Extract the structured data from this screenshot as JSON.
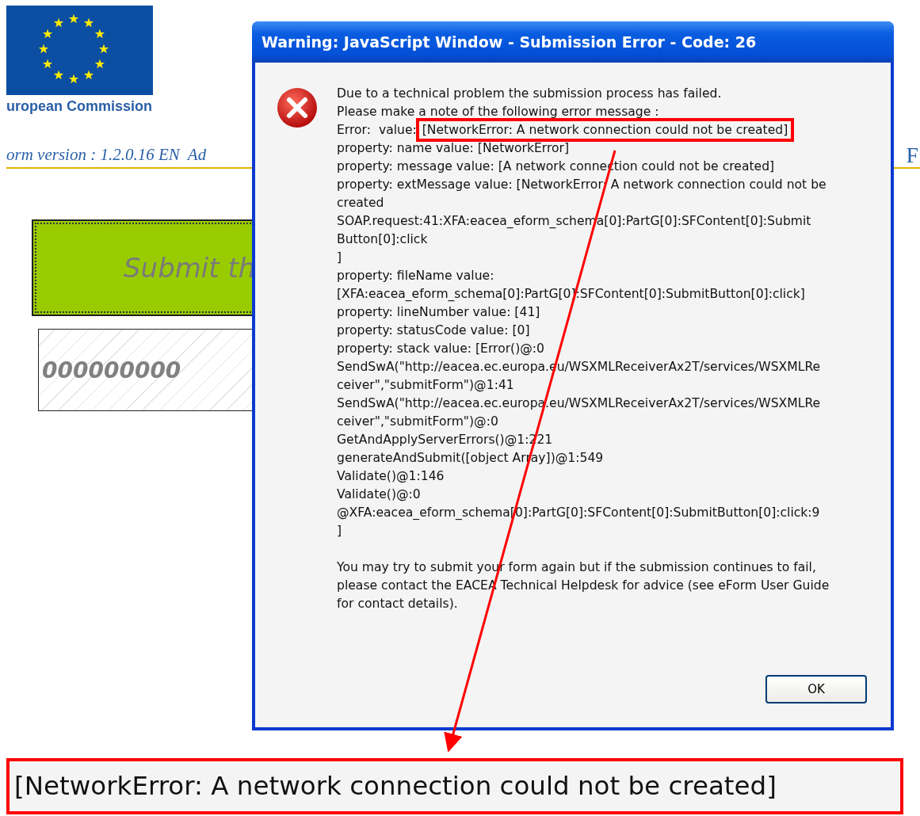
{
  "background_page": {
    "logo_caption": "uropean Commission",
    "form_version": "orm version : 1.2.0.16 EN  Ad",
    "right_heading": "F",
    "submit_button": "Submit th",
    "reference_field": {
      "value": "000000000"
    }
  },
  "dialog": {
    "title": "Warning: JavaScript Window - Submission Error - Code: 26",
    "message_lines": [
      {
        "text": "Due to a technical problem the submission process has failed."
      },
      {
        "text": "Please make a note of the following error message :"
      },
      {
        "text": "Error:  value: ",
        "highlight": "[NetworkError: A network connection could not be created]"
      },
      {
        "text": "property: name value: [NetworkError]"
      },
      {
        "text": "property: message value: [A network connection could not be created]"
      },
      {
        "text": "property: extMessage value: [NetworkError: A network connection could not be"
      },
      {
        "text": "created"
      },
      {
        "text": "SOAP.request:41:XFA:eacea_eform_schema[0]:PartG[0]:SFContent[0]:Submit"
      },
      {
        "text": "Button[0]:click"
      },
      {
        "text": "]"
      },
      {
        "text": "property: fileName value:"
      },
      {
        "text": "[XFA:eacea_eform_schema[0]:PartG[0]:SFContent[0]:SubmitButton[0]:click]"
      },
      {
        "text": "property: lineNumber value: [41]"
      },
      {
        "text": "property: statusCode value: [0]"
      },
      {
        "text": "property: stack value: [Error()@:0"
      },
      {
        "text": "SendSwA(\"http://eacea.ec.europa.eu/WSXMLReceiverAx2T/services/WSXMLRe"
      },
      {
        "text": "ceiver\",\"submitForm\")@1:41"
      },
      {
        "text": "SendSwA(\"http://eacea.ec.europa.eu/WSXMLReceiverAx2T/services/WSXMLRe"
      },
      {
        "text": "ceiver\",\"submitForm\")@:0"
      },
      {
        "text": "GetAndApplyServerErrors()@1:221"
      },
      {
        "text": "generateAndSubmit([object Array])@1:549"
      },
      {
        "text": "Validate()@1:146"
      },
      {
        "text": "Validate()@:0"
      },
      {
        "text": "@XFA:eacea_eform_schema[0]:PartG[0]:SFContent[0]:SubmitButton[0]:click:9"
      },
      {
        "text": "]"
      }
    ],
    "advice_lines": [
      "You may try to submit your form again but if the submission continues to fail,",
      "please contact the EACEA Technical Helpdesk for advice (see eForm User Guide",
      "for contact details)."
    ],
    "ok_button": "OK"
  },
  "callout": {
    "text": "[NetworkError: A network connection could not be created]"
  }
}
